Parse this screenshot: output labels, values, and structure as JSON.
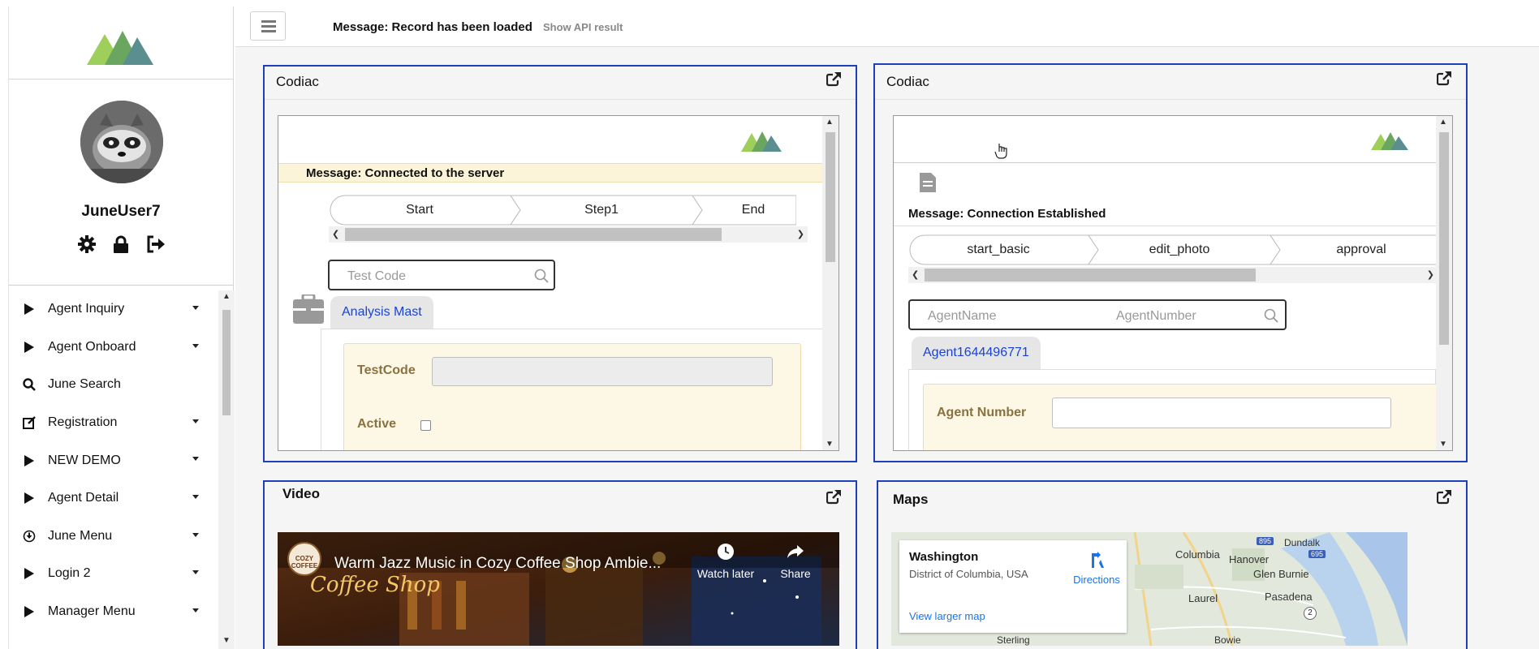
{
  "app": {
    "username": "JuneUser7",
    "accent_color": "#1e3fb8"
  },
  "topbar": {
    "message": "Message: Record has been loaded",
    "api_link": "Show API result"
  },
  "sidebar": {
    "profile_icons": [
      "gear-icon",
      "lock-icon",
      "sign-out-icon"
    ],
    "items": [
      {
        "label": "Agent Inquiry",
        "icon": "triangle-right-icon",
        "caret": true
      },
      {
        "label": "Agent Onboard",
        "icon": "triangle-right-icon",
        "caret": true
      },
      {
        "label": "June Search",
        "icon": "search-icon",
        "caret": false
      },
      {
        "label": "Registration",
        "icon": "edit-icon",
        "caret": true
      },
      {
        "label": "NEW DEMO",
        "icon": "triangle-right-icon",
        "caret": true
      },
      {
        "label": "Agent Detail",
        "icon": "triangle-right-icon",
        "caret": true
      },
      {
        "label": "June Menu",
        "icon": "circle-down-icon",
        "caret": true
      },
      {
        "label": "Login 2",
        "icon": "triangle-right-icon",
        "caret": true
      },
      {
        "label": "Manager Menu",
        "icon": "triangle-right-icon",
        "caret": true
      }
    ]
  },
  "panel1": {
    "title": "Codiac",
    "banner": "Message: Connected to the server",
    "steps": [
      "Start",
      "Step1",
      "End"
    ],
    "search_placeholder": "Test Code",
    "tab": "Analysis Mast",
    "fields": {
      "testcode_label": "TestCode",
      "active_label": "Active"
    }
  },
  "panel2": {
    "title": "Codiac",
    "banner": "Message: Connection Established",
    "steps": [
      "start_basic",
      "edit_photo",
      "approval"
    ],
    "search_placeholder_1": "AgentName",
    "search_placeholder_2": "AgentNumber",
    "tab": "Agent1644496771",
    "fields": {
      "agent_number_label": "Agent Number"
    }
  },
  "panel3": {
    "title": "Video",
    "video_title": "Warm Jazz Music in Cozy Coffee Shop Ambie...",
    "watch_later": "Watch later",
    "share": "Share",
    "channel_logo_text": "COZY COFFEE",
    "overlay_text": "Coffee Shop"
  },
  "panel4": {
    "title": "Maps",
    "place": "Washington",
    "region": "District of Columbia, USA",
    "directions": "Directions",
    "larger_map": "View larger map",
    "map_labels": [
      "Dundalk",
      "Columbia",
      "Hanover",
      "Glen Burnie",
      "Laurel",
      "Pasadena",
      "Sterling",
      "Bowie"
    ],
    "road_labels": [
      "895",
      "695",
      "2"
    ]
  }
}
